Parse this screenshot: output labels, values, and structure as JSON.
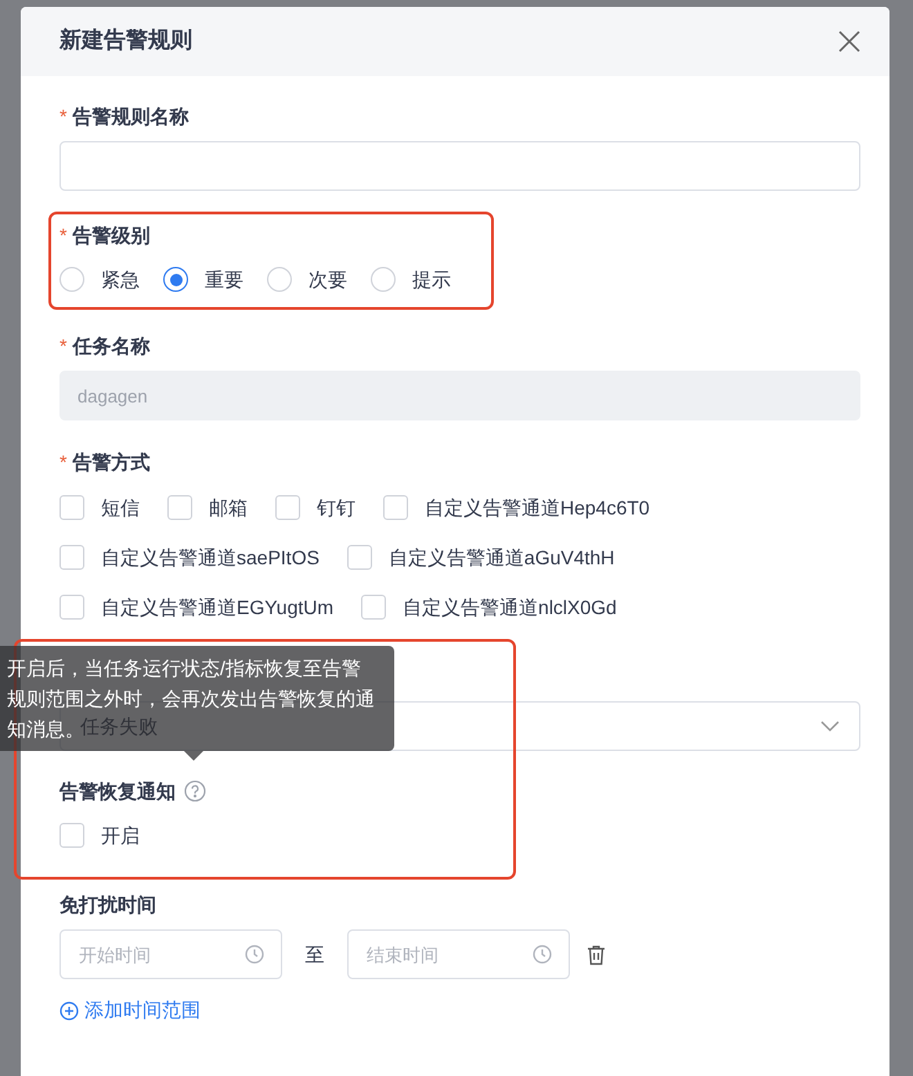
{
  "dialog": {
    "title": "新建告警规则"
  },
  "rule_name": {
    "label": "告警规则名称",
    "required_mark": "*"
  },
  "level": {
    "label": "告警级别",
    "required_mark": "*",
    "options": [
      {
        "label": "紧急",
        "selected": false
      },
      {
        "label": "重要",
        "selected": true
      },
      {
        "label": "次要",
        "selected": false
      },
      {
        "label": "提示",
        "selected": false
      }
    ]
  },
  "task_name": {
    "label": "任务名称",
    "required_mark": "*",
    "value": "dagagen",
    "disabled": true
  },
  "method": {
    "label": "告警方式",
    "required_mark": "*",
    "options": [
      {
        "label": "短信",
        "checked": false
      },
      {
        "label": "邮箱",
        "checked": false
      },
      {
        "label": "钉钉",
        "checked": false
      },
      {
        "label": "自定义告警通道Hep4c6T0",
        "checked": false
      },
      {
        "label": "自定义告警通道saePItOS",
        "checked": false
      },
      {
        "label": "自定义告警通道aGuV4thH",
        "checked": false
      },
      {
        "label": "自定义告警通道EGYugtUm",
        "checked": false
      },
      {
        "label": "自定义告警通道nlclX0Gd",
        "checked": false
      }
    ]
  },
  "trigger": {
    "value": "任务失败"
  },
  "recovery": {
    "label": "告警恢复通知",
    "option": {
      "label": "开启",
      "checked": false
    }
  },
  "tooltip": {
    "text": "开启后，当任务运行状态/指标恢复至告警规则范围之外时，会再次发出告警恢复的通知消息。"
  },
  "quiet_time": {
    "label": "免打扰时间",
    "start_placeholder": "开始时间",
    "separator": "至",
    "end_placeholder": "结束时间",
    "add_link": "添加时间范围"
  }
}
